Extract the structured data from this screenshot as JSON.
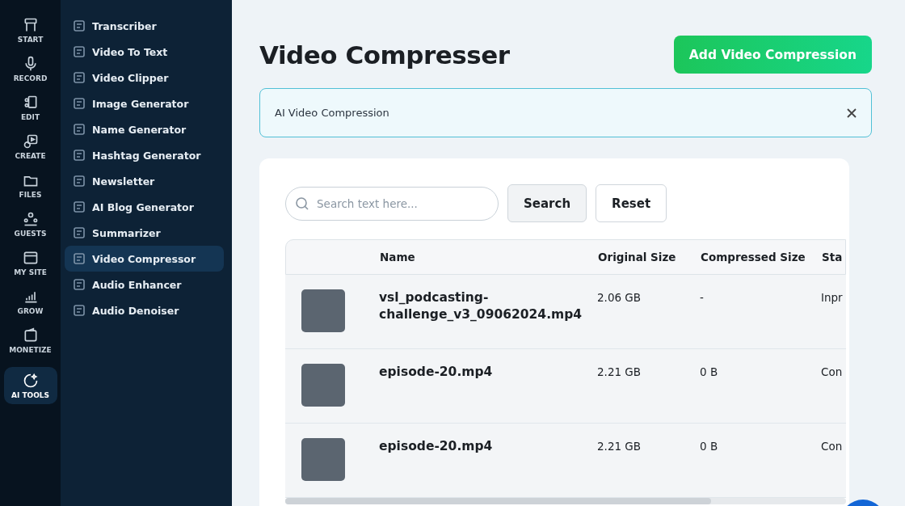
{
  "rail": [
    {
      "label": "START",
      "selected": false
    },
    {
      "label": "RECORD",
      "selected": false
    },
    {
      "label": "EDIT",
      "selected": false
    },
    {
      "label": "CREATE",
      "selected": false
    },
    {
      "label": "FILES",
      "selected": false
    },
    {
      "label": "GUESTS",
      "selected": false
    },
    {
      "label": "MY SITE",
      "selected": false
    },
    {
      "label": "GROW",
      "selected": false
    },
    {
      "label": "MONETIZE",
      "selected": false
    },
    {
      "label": "AI TOOLS",
      "selected": true
    }
  ],
  "tools": [
    {
      "label": "Transcriber",
      "selected": false
    },
    {
      "label": "Video To Text",
      "selected": false
    },
    {
      "label": "Video Clipper",
      "selected": false
    },
    {
      "label": "Image Generator",
      "selected": false
    },
    {
      "label": "Name Generator",
      "selected": false
    },
    {
      "label": "Hashtag Generator",
      "selected": false
    },
    {
      "label": "Newsletter",
      "selected": false
    },
    {
      "label": "AI Blog Generator",
      "selected": false
    },
    {
      "label": "Summarizer",
      "selected": false
    },
    {
      "label": "Video Compressor",
      "selected": true
    },
    {
      "label": "Audio Enhancer",
      "selected": false
    },
    {
      "label": "Audio Denoiser",
      "selected": false
    }
  ],
  "page": {
    "title": "Video Compresser",
    "add_button": "Add Video Compression"
  },
  "alert": {
    "text": "AI Video Compression"
  },
  "search": {
    "placeholder": "Search text here...",
    "search_button": "Search",
    "reset_button": "Reset"
  },
  "table": {
    "columns": [
      "Name",
      "Original Size",
      "Compressed Size",
      "Sta"
    ],
    "rows": [
      {
        "name": "vsl_podcasting-challenge_v3_09062024.mp4",
        "original_size": "2.06 GB",
        "compressed_size": "-",
        "column_4": "Inpr"
      },
      {
        "name": "episode-20.mp4",
        "original_size": "2.21 GB",
        "compressed_size": "0 B",
        "column_4": "Con"
      },
      {
        "name": "episode-20.mp4",
        "original_size": "2.21 GB",
        "compressed_size": "0 B",
        "column_4": "Con"
      }
    ]
  }
}
